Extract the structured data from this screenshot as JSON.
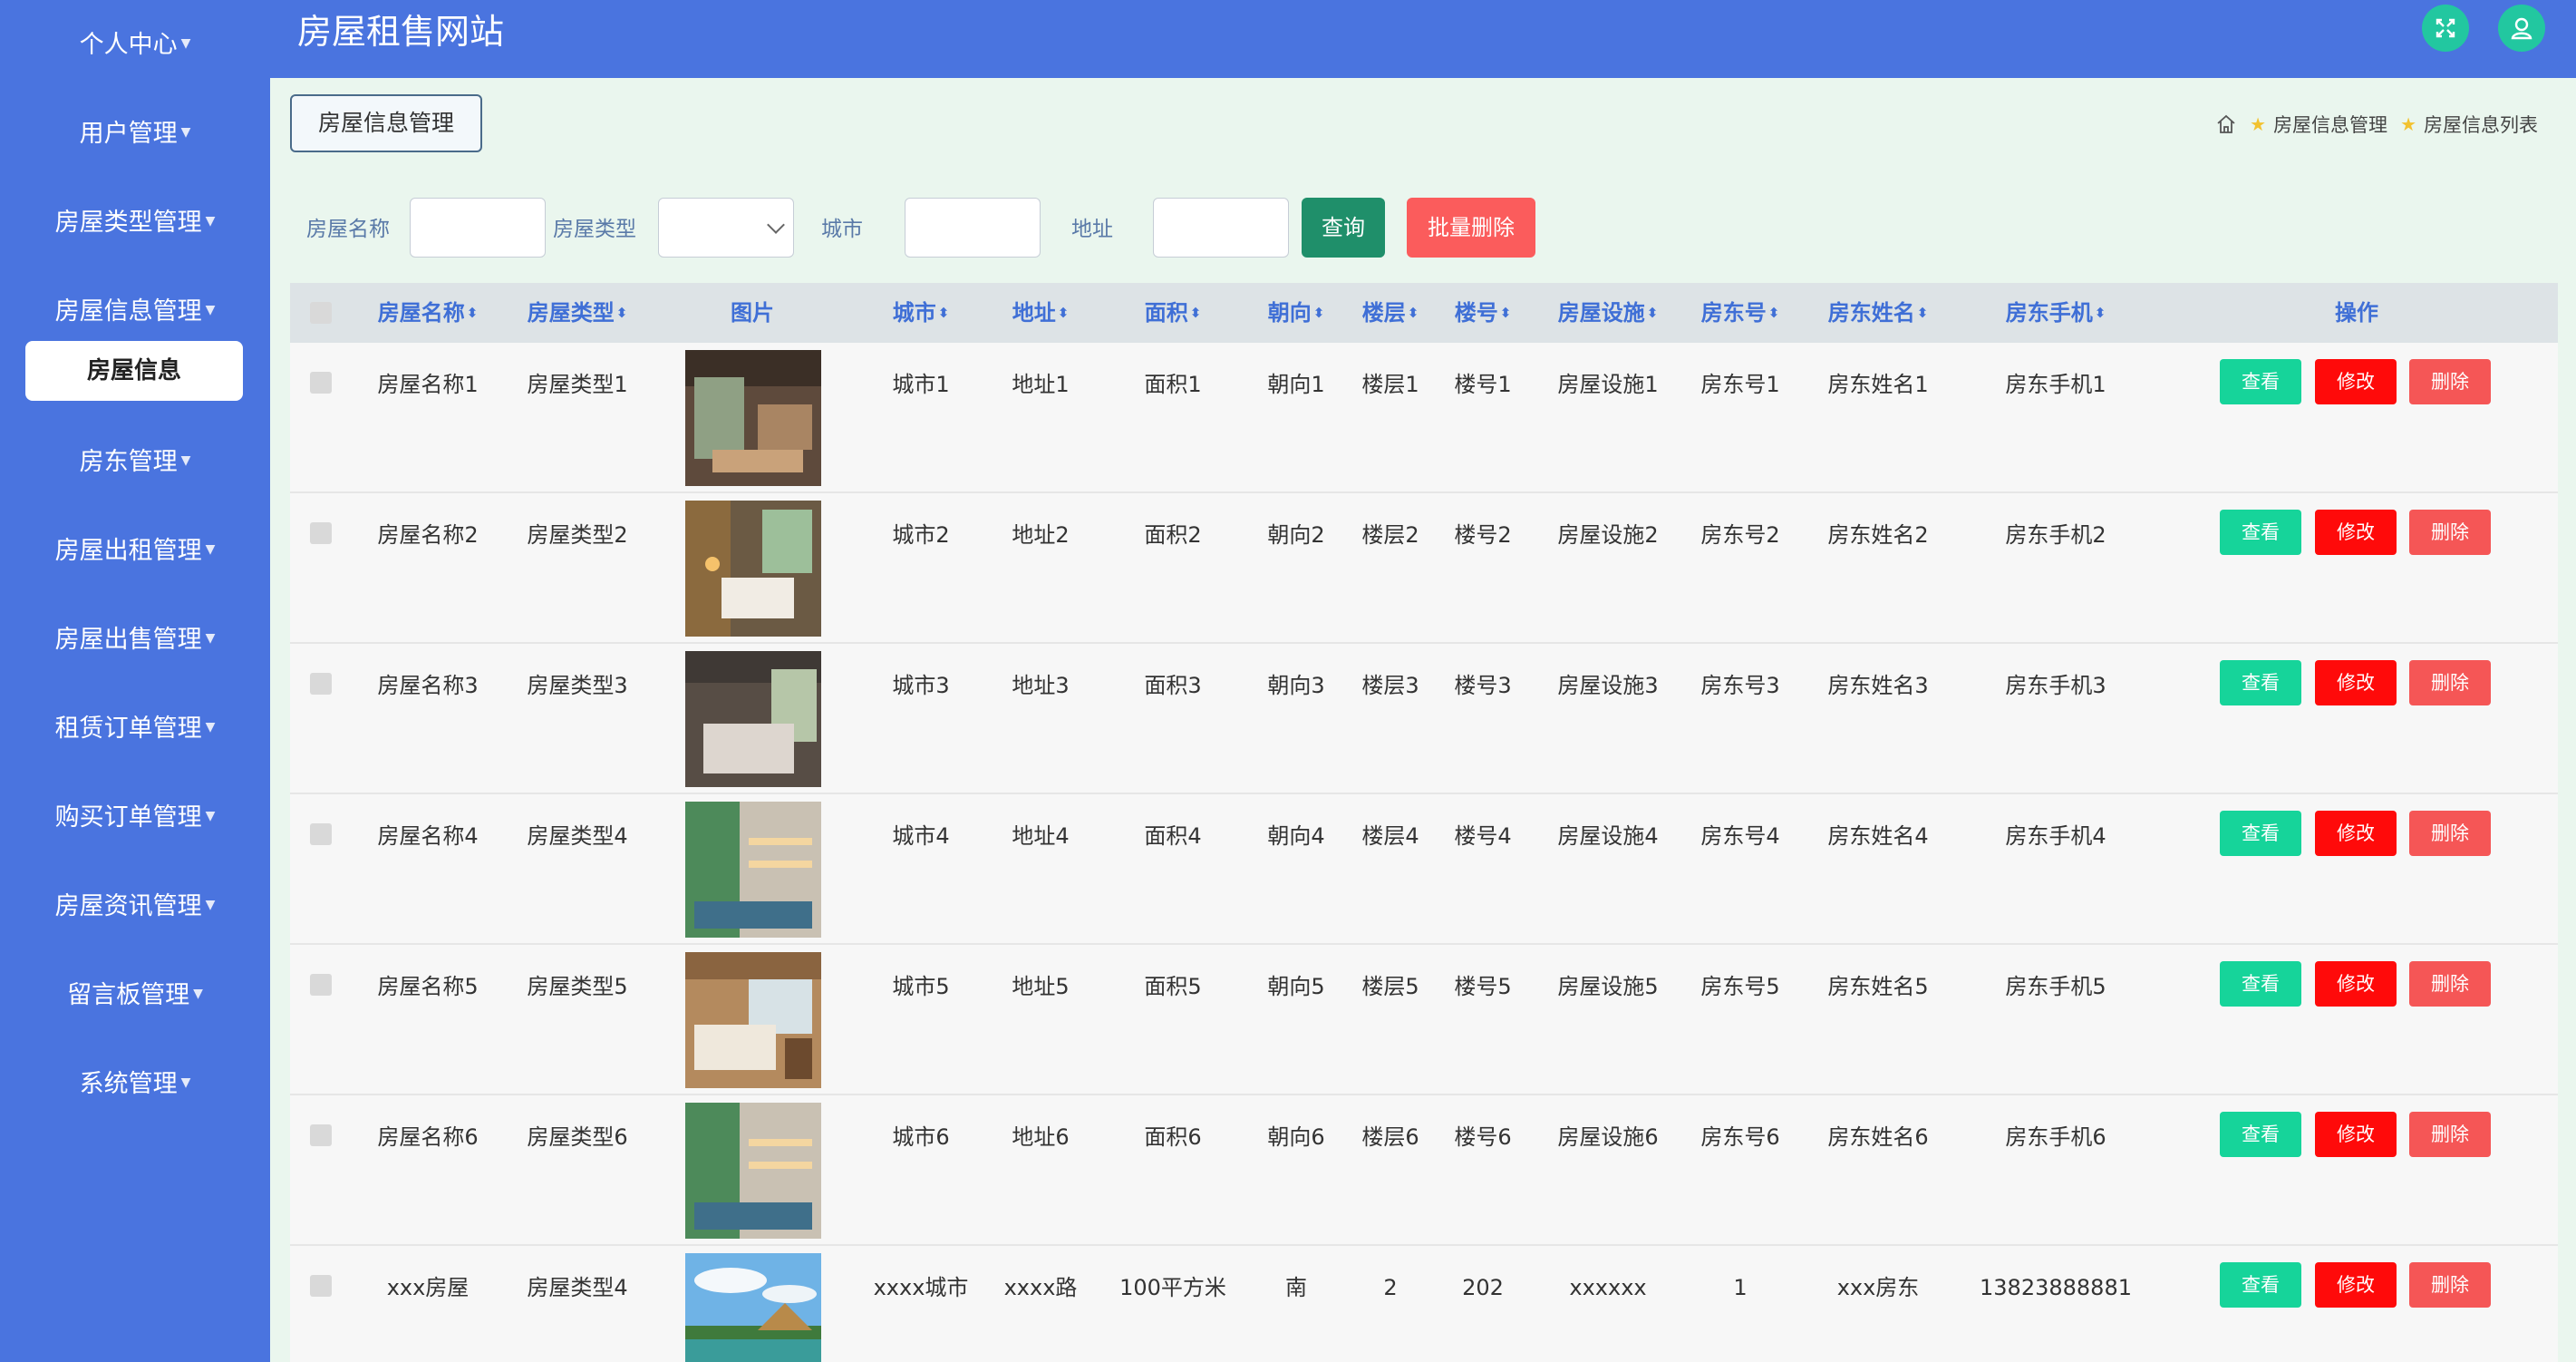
{
  "header": {
    "site_title": "房屋租售网站",
    "fullscreen_icon": "fullscreen-icon",
    "user_icon": "user-icon"
  },
  "sidebar": {
    "items": [
      {
        "label": "个人中心"
      },
      {
        "label": "用户管理"
      },
      {
        "label": "房屋类型管理"
      },
      {
        "label": "房屋信息管理"
      },
      {
        "label": "房东管理"
      },
      {
        "label": "房屋出租管理"
      },
      {
        "label": "房屋出售管理"
      },
      {
        "label": "租赁订单管理"
      },
      {
        "label": "购买订单管理"
      },
      {
        "label": "房屋资讯管理"
      },
      {
        "label": "留言板管理"
      },
      {
        "label": "系统管理"
      }
    ],
    "active_sub": "房屋信息"
  },
  "main": {
    "page_tag": "房屋信息管理",
    "breadcrumb": [
      "房屋信息管理",
      "房屋信息列表"
    ]
  },
  "search": {
    "name_label": "房屋名称",
    "type_label": "房屋类型",
    "city_label": "城市",
    "address_label": "地址",
    "name_value": "",
    "type_value": "",
    "city_value": "",
    "address_value": "",
    "query_button": "查询",
    "batch_delete_button": "批量删除"
  },
  "table": {
    "headers": [
      "房屋名称",
      "房屋类型",
      "图片",
      "城市",
      "地址",
      "面积",
      "朝向",
      "楼层",
      "楼号",
      "房屋设施",
      "房东号",
      "房东姓名",
      "房东手机",
      "操作"
    ],
    "actions": {
      "view": "查看",
      "edit": "修改",
      "delete": "删除"
    },
    "rows": [
      {
        "name": "房屋名称1",
        "type": "房屋类型1",
        "city": "城市1",
        "address": "地址1",
        "area": "面积1",
        "orientation": "朝向1",
        "floor": "楼层1",
        "building": "楼号1",
        "facilities": "房屋设施1",
        "landlord_no": "房东号1",
        "landlord_name": "房东姓名1",
        "landlord_phone": "房东手机1"
      },
      {
        "name": "房屋名称2",
        "type": "房屋类型2",
        "city": "城市2",
        "address": "地址2",
        "area": "面积2",
        "orientation": "朝向2",
        "floor": "楼层2",
        "building": "楼号2",
        "facilities": "房屋设施2",
        "landlord_no": "房东号2",
        "landlord_name": "房东姓名2",
        "landlord_phone": "房东手机2"
      },
      {
        "name": "房屋名称3",
        "type": "房屋类型3",
        "city": "城市3",
        "address": "地址3",
        "area": "面积3",
        "orientation": "朝向3",
        "floor": "楼层3",
        "building": "楼号3",
        "facilities": "房屋设施3",
        "landlord_no": "房东号3",
        "landlord_name": "房东姓名3",
        "landlord_phone": "房东手机3"
      },
      {
        "name": "房屋名称4",
        "type": "房屋类型4",
        "city": "城市4",
        "address": "地址4",
        "area": "面积4",
        "orientation": "朝向4",
        "floor": "楼层4",
        "building": "楼号4",
        "facilities": "房屋设施4",
        "landlord_no": "房东号4",
        "landlord_name": "房东姓名4",
        "landlord_phone": "房东手机4"
      },
      {
        "name": "房屋名称5",
        "type": "房屋类型5",
        "city": "城市5",
        "address": "地址5",
        "area": "面积5",
        "orientation": "朝向5",
        "floor": "楼层5",
        "building": "楼号5",
        "facilities": "房屋设施5",
        "landlord_no": "房东号5",
        "landlord_name": "房东姓名5",
        "landlord_phone": "房东手机5"
      },
      {
        "name": "房屋名称6",
        "type": "房屋类型6",
        "city": "城市6",
        "address": "地址6",
        "area": "面积6",
        "orientation": "朝向6",
        "floor": "楼层6",
        "building": "楼号6",
        "facilities": "房屋设施6",
        "landlord_no": "房东号6",
        "landlord_name": "房东姓名6",
        "landlord_phone": "房东手机6"
      },
      {
        "name": "xxx房屋",
        "type": "房屋类型4",
        "city": "xxxx城市",
        "address": "xxxx路",
        "area": "100平方米",
        "orientation": "南",
        "floor": "2",
        "building": "202",
        "facilities": "xxxxxx",
        "landlord_no": "1",
        "landlord_name": "xxx房东",
        "landlord_phone": "13823888881"
      }
    ]
  },
  "colors": {
    "sidebar_bg": "#4a74df",
    "main_bg": "#eaf6ee",
    "header_link": "#3f6fd6",
    "view_button": "#16d49a",
    "edit_button": "#ff0a0a",
    "delete_button": "#f55656",
    "query_button": "#1f8f6a",
    "batch_delete_button": "#fb5c5c"
  }
}
